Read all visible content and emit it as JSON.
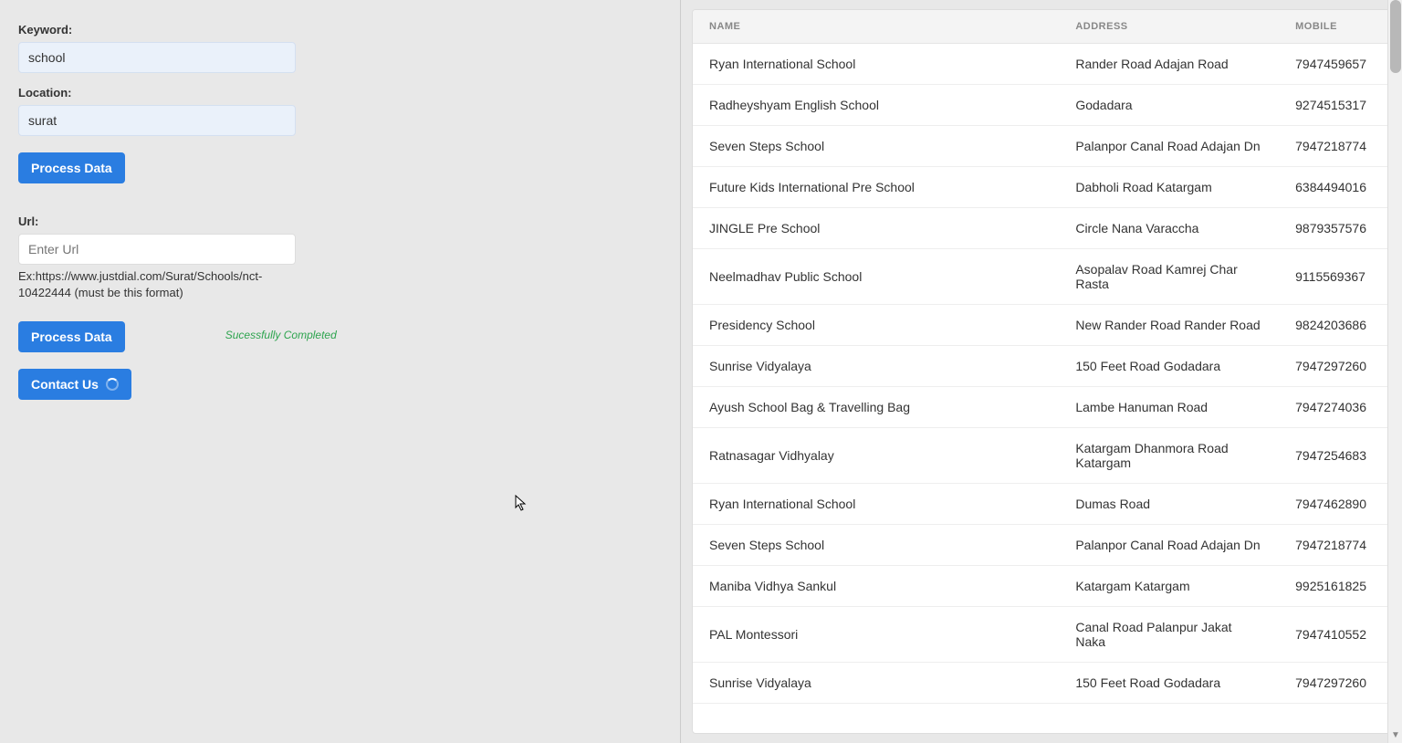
{
  "form": {
    "keyword_label": "Keyword:",
    "keyword_value": "school",
    "location_label": "Location:",
    "location_value": "surat",
    "process_btn": "Process Data",
    "url_label": "Url:",
    "url_placeholder": "Enter Url",
    "url_hint": "Ex:https://www.justdial.com/Surat/Schools/nct-10422444 (must be this format)",
    "process_btn2": "Process Data",
    "status": "Sucessfully Completed",
    "contact_btn": "Contact Us"
  },
  "table": {
    "headers": {
      "name": "NAME",
      "address": "ADDRESS",
      "mobile": "MOBILE"
    },
    "rows": [
      {
        "name": "Ryan International School",
        "address": "Rander Road Adajan Road",
        "mobile": "7947459657"
      },
      {
        "name": "Radheyshyam English School",
        "address": "Godadara",
        "mobile": "9274515317"
      },
      {
        "name": "Seven Steps School",
        "address": "Palanpor Canal Road Adajan Dn",
        "mobile": "7947218774"
      },
      {
        "name": "Future Kids International Pre School",
        "address": "Dabholi Road Katargam",
        "mobile": "6384494016"
      },
      {
        "name": "JINGLE Pre School",
        "address": "Circle Nana Varaccha",
        "mobile": "9879357576"
      },
      {
        "name": "Neelmadhav Public School",
        "address": "Asopalav Road Kamrej Char Rasta",
        "mobile": "9115569367"
      },
      {
        "name": "Presidency School",
        "address": "New Rander Road Rander Road",
        "mobile": "9824203686"
      },
      {
        "name": "Sunrise Vidyalaya",
        "address": "150 Feet Road Godadara",
        "mobile": "7947297260"
      },
      {
        "name": "Ayush School Bag & Travelling Bag",
        "address": "Lambe Hanuman Road",
        "mobile": "7947274036"
      },
      {
        "name": "Ratnasagar Vidhyalay",
        "address": "Katargam Dhanmora Road Katargam",
        "mobile": "7947254683"
      },
      {
        "name": "Ryan International School",
        "address": "Dumas Road",
        "mobile": "7947462890"
      },
      {
        "name": "Seven Steps School",
        "address": "Palanpor Canal Road Adajan Dn",
        "mobile": "7947218774"
      },
      {
        "name": "Maniba Vidhya Sankul",
        "address": "Katargam Katargam",
        "mobile": "9925161825"
      },
      {
        "name": "PAL Montessori",
        "address": "Canal Road Palanpur Jakat Naka",
        "mobile": "7947410552"
      },
      {
        "name": "Sunrise Vidyalaya",
        "address": "150 Feet Road Godadara",
        "mobile": "7947297260"
      }
    ]
  }
}
